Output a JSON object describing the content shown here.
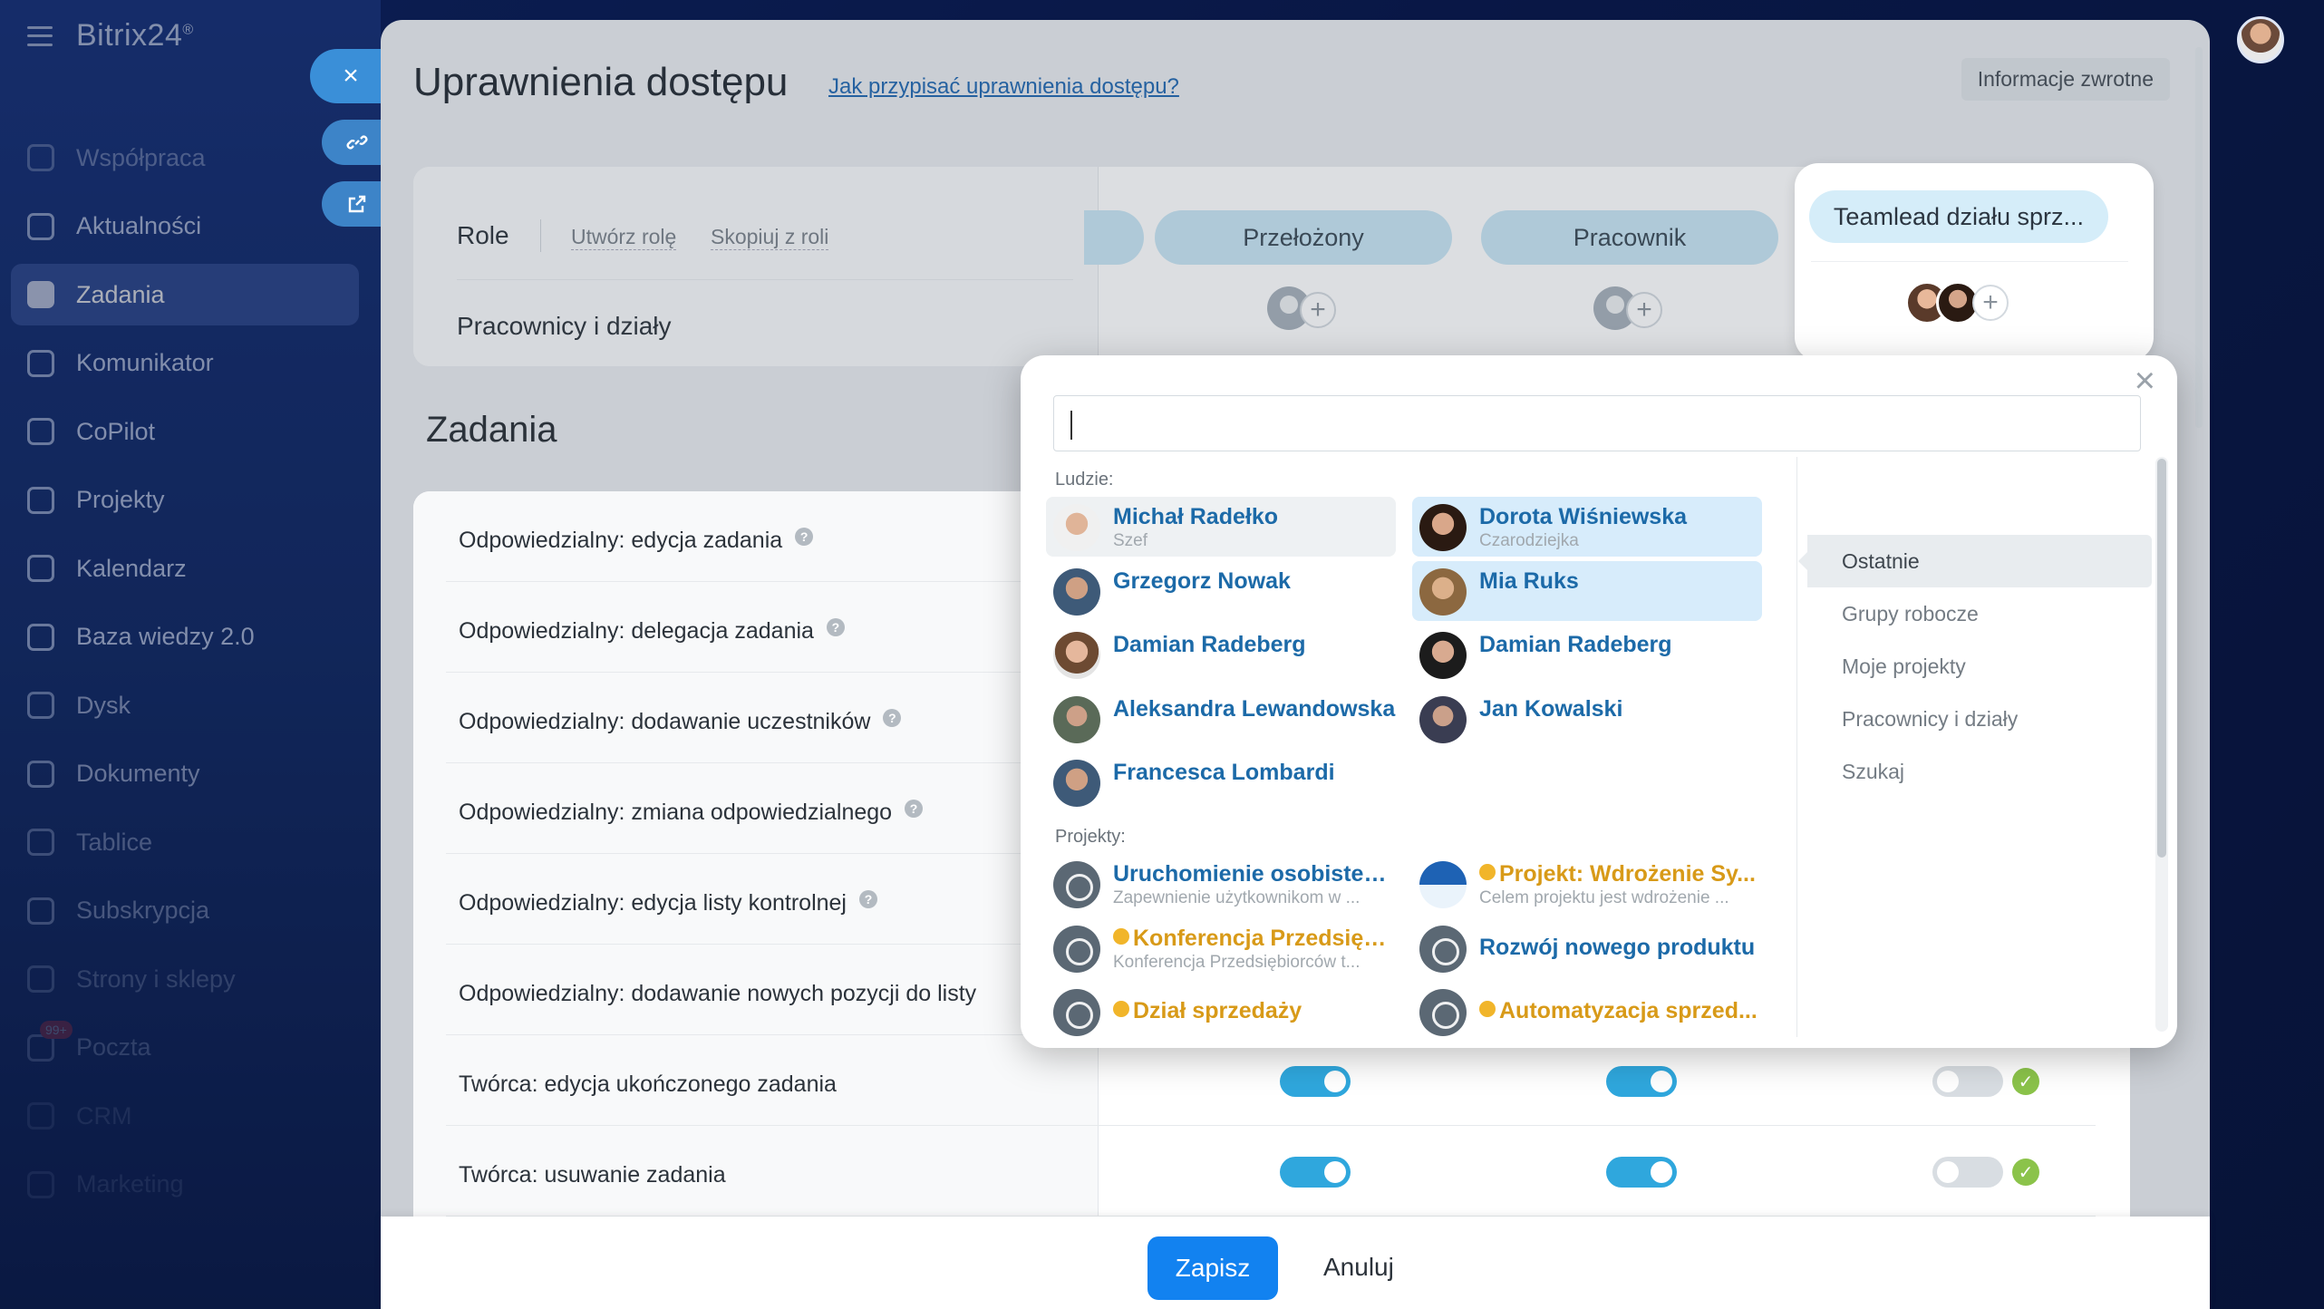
{
  "app": {
    "logo": "Bitrix24",
    "logo_mark": "®"
  },
  "sidebar": {
    "items": [
      {
        "label": "Współpraca",
        "icon": "collab-icon"
      },
      {
        "label": "Aktualności",
        "icon": "news-icon"
      },
      {
        "label": "Zadania",
        "icon": "tasks-icon",
        "active": true
      },
      {
        "label": "Komunikator",
        "icon": "chat-icon"
      },
      {
        "label": "CoPilot",
        "icon": "copilot-icon"
      },
      {
        "label": "Projekty",
        "icon": "projects-icon"
      },
      {
        "label": "Kalendarz",
        "icon": "calendar-icon"
      },
      {
        "label": "Baza wiedzy 2.0",
        "icon": "knowledge-icon"
      },
      {
        "label": "Dysk",
        "icon": "drive-icon"
      },
      {
        "label": "Dokumenty",
        "icon": "documents-icon"
      },
      {
        "label": "Tablice",
        "icon": "boards-icon"
      },
      {
        "label": "Subskrypcja",
        "icon": "subscription-icon"
      },
      {
        "label": "Strony i sklepy",
        "icon": "sites-icon"
      },
      {
        "label": "Poczta",
        "icon": "mail-icon",
        "badge": "99+"
      },
      {
        "label": "CRM",
        "icon": "crm-icon"
      },
      {
        "label": "Marketing",
        "icon": "marketing-icon"
      }
    ]
  },
  "side_buttons": {
    "close": "×",
    "link": "link-icon",
    "open": "external-icon"
  },
  "header": {
    "title": "Uprawnienia dostępu",
    "help_link": "Jak przypisać uprawnienia dostępu?",
    "feedback": "Informacje zwrotne"
  },
  "roles": {
    "label": "Role",
    "create": "Utwórz rolę",
    "copy": "Skopiuj z roli",
    "members_label": "Pracownicy i działy",
    "columns": [
      "Przełożony",
      "Pracownik",
      "Teamlead działu sprz..."
    ]
  },
  "section": {
    "title": "Zadania"
  },
  "permissions": [
    {
      "label": "Odpowiedzialny: edycja zadania",
      "help": true
    },
    {
      "label": "Odpowiedzialny: delegacja zadania",
      "help": true
    },
    {
      "label": "Odpowiedzialny: dodawanie uczestników",
      "help": true
    },
    {
      "label": "Odpowiedzialny: zmiana odpowiedzialnego",
      "help": true
    },
    {
      "label": "Odpowiedzialny: edycja listy kontrolnej",
      "help": true
    },
    {
      "label": "Odpowiedzialny: dodawanie nowych pozycji do listy",
      "help": false
    },
    {
      "label": "Twórca: edycja ukończonego zadania",
      "values": [
        true,
        true,
        false
      ]
    },
    {
      "label": "Twórca: usuwanie zadania",
      "values": [
        true,
        true,
        false
      ]
    }
  ],
  "footer": {
    "save": "Zapisz",
    "cancel": "Anuluj"
  },
  "popup": {
    "search_value": "",
    "people_label": "Ludzie:",
    "people": [
      {
        "name": "Michał Radełko",
        "sub": "Szef",
        "state": "hover"
      },
      {
        "name": "Dorota Wiśniewska",
        "sub": "Czarodziejka",
        "state": "selected"
      },
      {
        "name": "Grzegorz Nowak",
        "sub": "",
        "state": ""
      },
      {
        "name": "Mia Ruks",
        "sub": "",
        "state": "selected"
      },
      {
        "name": "Damian Radeberg",
        "sub": "",
        "state": ""
      },
      {
        "name": "Damian Radeberg",
        "sub": "",
        "state": ""
      },
      {
        "name": "Aleksandra Lewandowska",
        "sub": "",
        "state": ""
      },
      {
        "name": "Jan Kowalski",
        "sub": "",
        "state": ""
      },
      {
        "name": "Francesca Lombardi",
        "sub": "",
        "state": ""
      }
    ],
    "projects_label": "Projekty:",
    "projects": [
      {
        "name": "Uruchomienie osobisteg...",
        "sub": "Zapewnienie użytkownikom w ...",
        "gold": false
      },
      {
        "name": "Projekt: Wdrożenie Sy...",
        "sub": "Celem projektu jest wdrożenie ...",
        "gold": true
      },
      {
        "name": "Konferencja Przedsięb...",
        "sub": "Konferencja Przedsiębiorców t...",
        "gold": true
      },
      {
        "name": "Rozwój nowego produktu",
        "sub": "",
        "gold": false
      },
      {
        "name": "Dział sprzedaży",
        "sub": "",
        "gold": true
      },
      {
        "name": "Automatyzacja sprzed...",
        "sub": "",
        "gold": true
      }
    ],
    "tabs": [
      "Ostatnie",
      "Grupy robocze",
      "Moje projekty",
      "Pracownicy i działy",
      "Szukaj"
    ],
    "active_tab": "Ostatnie",
    "colors": {
      "link": "#1c6aa8",
      "gold": "#d89a18",
      "selected": "#d7ecfb"
    }
  }
}
